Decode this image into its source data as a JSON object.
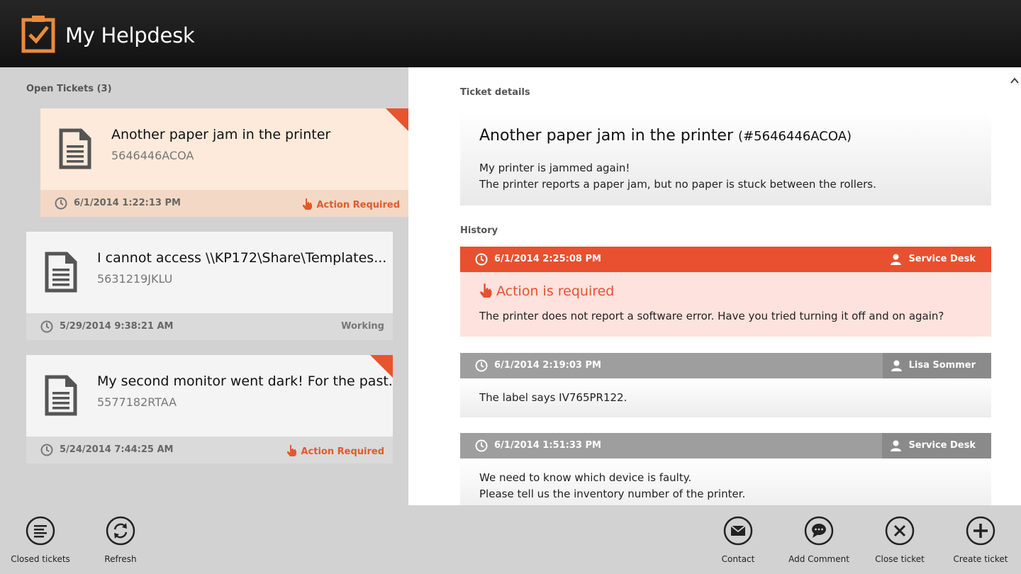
{
  "app": {
    "title": "My Helpdesk"
  },
  "left": {
    "section_label": "Open Tickets (3)",
    "tickets": [
      {
        "title": "Another paper jam in the printer",
        "id": "5646446ACOA",
        "date": "6/1/2014 1:22:13 PM",
        "status": "Action Required",
        "selected": true
      },
      {
        "title": "I cannot access \\\\KP172\\Share\\Templates...",
        "id": "5631219JKLU",
        "date": "5/29/2014 9:38:21 AM",
        "status": "Working",
        "selected": false
      },
      {
        "title": "My second monitor went dark! For the past...",
        "id": "5577182RTAA",
        "date": "5/24/2014 7:44:25 AM",
        "status": "Action Required",
        "selected": false
      }
    ]
  },
  "detail": {
    "section_label": "Ticket details",
    "title": "Another paper jam in the printer",
    "number": "(#5646446ACOA)",
    "lines": [
      "My printer is jammed again!",
      "The printer reports a paper jam, but no paper is stuck between the rollers."
    ]
  },
  "history": {
    "section_label": "History",
    "entries": [
      {
        "date": "6/1/2014 2:25:08 PM",
        "user": "Service Desk",
        "action": "Action is required",
        "lines": [
          "The printer does not report a software error. Have you tried turning it off and on again?"
        ]
      },
      {
        "date": "6/1/2014 2:19:03 PM",
        "user": "Lisa Sommer",
        "lines": [
          "The label says IV765PR122."
        ]
      },
      {
        "date": "6/1/2014 1:51:33 PM",
        "user": "Service Desk",
        "lines": [
          "We need to know which device is faulty.",
          "Please tell us the inventory number of the printer."
        ]
      }
    ]
  },
  "appbar": {
    "closed_tickets": "Closed tickets",
    "refresh": "Refresh",
    "contact": "Contact",
    "add_comment": "Add Comment",
    "close_ticket": "Close ticket",
    "create_ticket": "Create ticket"
  },
  "colors": {
    "accent": "#e8502f",
    "selection": "#ec8a3b",
    "header": "#1a1a1a"
  }
}
